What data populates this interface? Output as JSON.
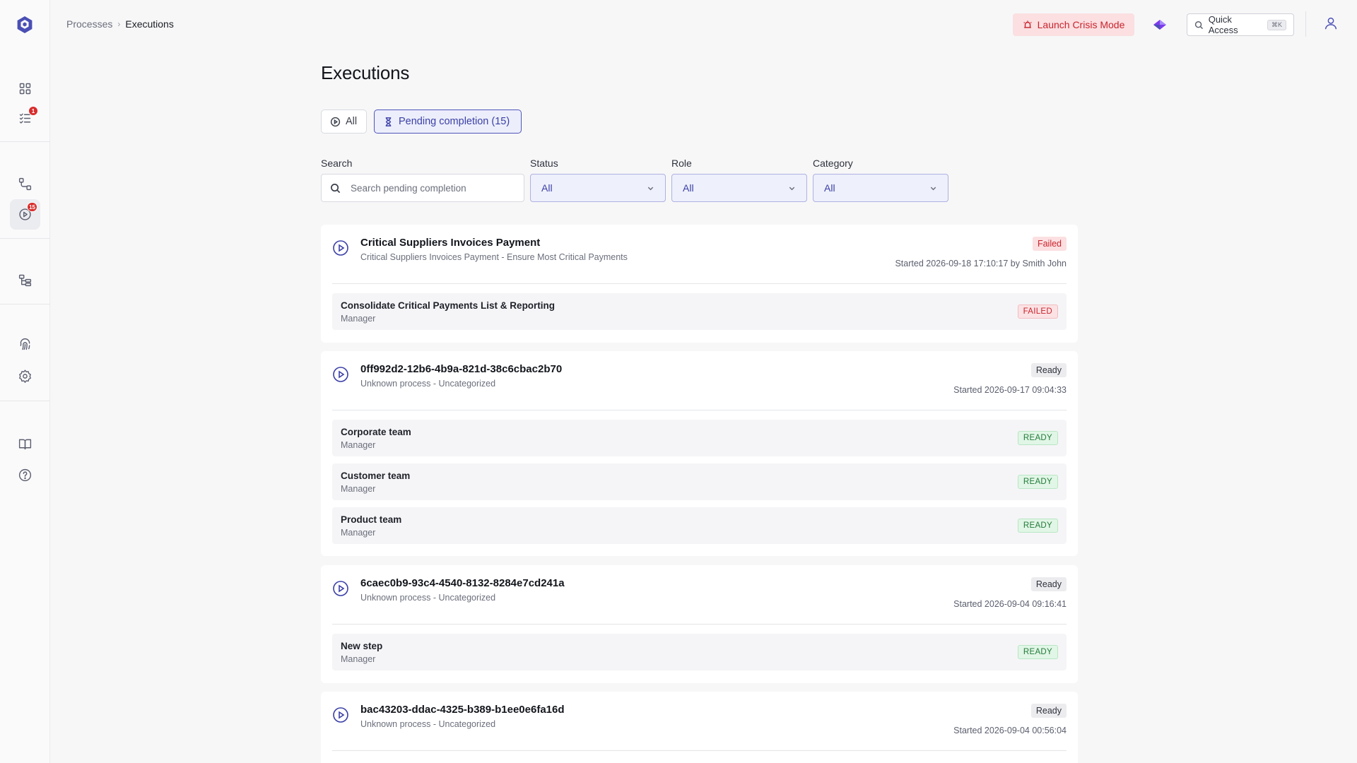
{
  "breadcrumb": {
    "parent": "Processes",
    "separator": "›",
    "current": "Executions"
  },
  "topbar": {
    "crisis_label": "Launch Crisis Mode",
    "quick_access_label": "Quick Access",
    "quick_access_kbd": "⌘K"
  },
  "sidebar": {
    "items": [
      {
        "name": "dashboard",
        "icon": "grid-icon"
      },
      {
        "name": "tasks",
        "icon": "checklist-icon",
        "badge": "1"
      },
      {
        "name": "processes",
        "icon": "workflow-icon"
      },
      {
        "name": "executions",
        "icon": "play-circle-icon",
        "badge": "15",
        "active": true
      },
      {
        "name": "organization",
        "icon": "hierarchy-icon"
      },
      {
        "name": "security",
        "icon": "fingerprint-icon"
      },
      {
        "name": "settings",
        "icon": "gear-icon"
      },
      {
        "name": "docs",
        "icon": "book-icon"
      },
      {
        "name": "help",
        "icon": "help-icon"
      }
    ]
  },
  "page": {
    "title": "Executions"
  },
  "tabs": {
    "all_label": "All",
    "pending_label": "Pending completion (15)"
  },
  "filters": {
    "search_label": "Search",
    "search_placeholder": "Search pending completion",
    "status_label": "Status",
    "status_value": "All",
    "role_label": "Role",
    "role_value": "All",
    "category_label": "Category",
    "category_value": "All"
  },
  "executions": [
    {
      "title": "Critical Suppliers Invoices Payment",
      "subtitle": "Critical Suppliers Invoices Payment - Ensure Most Critical Payments",
      "status": "Failed",
      "started": "Started 2026-09-18 17:10:17 by Smith John",
      "steps": [
        {
          "name": "Consolidate Critical Payments List & Reporting",
          "role": "Manager",
          "status": "FAILED"
        }
      ]
    },
    {
      "title": "0ff992d2-12b6-4b9a-821d-38c6cbac2b70",
      "subtitle": "Unknown process - Uncategorized",
      "status": "Ready",
      "started": "Started 2026-09-17 09:04:33",
      "steps": [
        {
          "name": "Corporate team",
          "role": "Manager",
          "status": "READY"
        },
        {
          "name": "Customer team",
          "role": "Manager",
          "status": "READY"
        },
        {
          "name": "Product team",
          "role": "Manager",
          "status": "READY"
        }
      ]
    },
    {
      "title": "6caec0b9-93c4-4540-8132-8284e7cd241a",
      "subtitle": "Unknown process - Uncategorized",
      "status": "Ready",
      "started": "Started 2026-09-04 09:16:41",
      "steps": [
        {
          "name": "New step",
          "role": "Manager",
          "status": "READY"
        }
      ]
    },
    {
      "title": "bac43203-ddac-4325-b389-b1ee0e6fa16d",
      "subtitle": "Unknown process - Uncategorized",
      "status": "Ready",
      "started": "Started 2026-09-04 00:56:04",
      "steps": []
    }
  ]
}
